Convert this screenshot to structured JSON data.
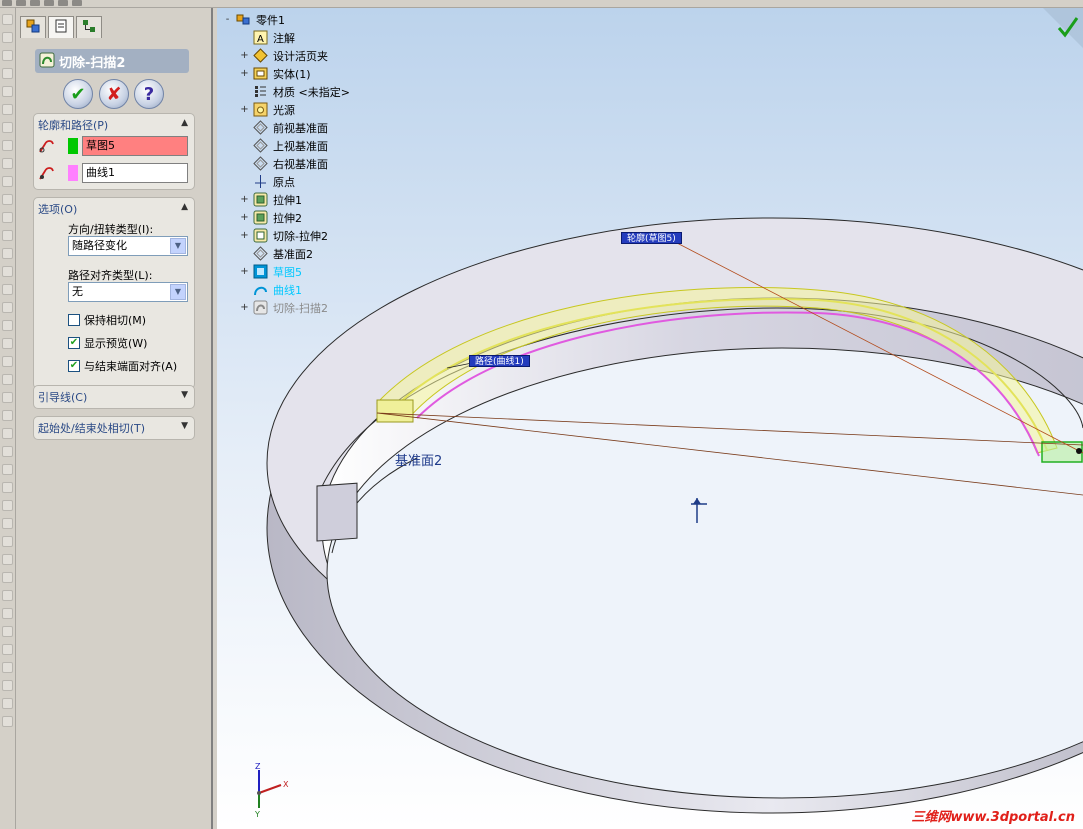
{
  "property_manager": {
    "title": "切除-扫描2",
    "buttons": {
      "ok": "✔",
      "cancel": "✘",
      "help": "?"
    },
    "profile_path": {
      "header": "轮廓和路径(P)",
      "profile_value": "草图5",
      "profile_color": "#ff8080",
      "profile_swatch": "#00c800",
      "path_value": "曲线1",
      "path_swatch": "#ff80ff"
    },
    "options": {
      "header": "选项(O)",
      "orientation_label": "方向/扭转类型(I):",
      "orientation_value": "随路径变化",
      "alignment_label": "路径对齐类型(L):",
      "alignment_value": "无",
      "keep_tangency": "保持相切(M)",
      "keep_tangency_checked": false,
      "show_preview": "显示预览(W)",
      "show_preview_checked": true,
      "align_end_faces": "与结束端面对齐(A)",
      "align_end_faces_checked": true
    },
    "guide_curves": {
      "header": "引导线(C)"
    },
    "start_end_tangency": {
      "header": "起始处/结束处相切(T)"
    }
  },
  "feature_tree": [
    {
      "label": "零件1",
      "icon": "part-icon",
      "expand": "-",
      "style": "normal"
    },
    {
      "label": "注解",
      "icon": "annotations-icon",
      "expand": "",
      "style": "normal"
    },
    {
      "label": "设计活页夹",
      "icon": "design-binder-icon",
      "expand": "+",
      "style": "normal"
    },
    {
      "label": "实体(1)",
      "icon": "solid-bodies-icon",
      "expand": "+",
      "style": "normal"
    },
    {
      "label": "材质 <未指定>",
      "icon": "material-icon",
      "expand": "",
      "style": "normal"
    },
    {
      "label": "光源",
      "icon": "lights-icon",
      "expand": "+",
      "style": "normal"
    },
    {
      "label": "前视基准面",
      "icon": "plane-icon",
      "expand": "",
      "style": "normal"
    },
    {
      "label": "上视基准面",
      "icon": "plane-icon",
      "expand": "",
      "style": "normal"
    },
    {
      "label": "右视基准面",
      "icon": "plane-icon",
      "expand": "",
      "style": "normal"
    },
    {
      "label": "原点",
      "icon": "origin-icon",
      "expand": "",
      "style": "normal"
    },
    {
      "label": "拉伸1",
      "icon": "extrude-icon",
      "expand": "+",
      "style": "normal"
    },
    {
      "label": "拉伸2",
      "icon": "extrude-icon",
      "expand": "+",
      "style": "normal"
    },
    {
      "label": "切除-拉伸2",
      "icon": "cut-extrude-icon",
      "expand": "+",
      "style": "normal"
    },
    {
      "label": "基准面2",
      "icon": "plane-icon",
      "expand": "",
      "style": "normal"
    },
    {
      "label": "草图5",
      "icon": "sketch-icon",
      "expand": "+",
      "style": "cyan"
    },
    {
      "label": "曲线1",
      "icon": "curve-icon",
      "expand": "",
      "style": "cyan"
    },
    {
      "label": "切除-扫描2",
      "icon": "cut-sweep-icon",
      "expand": "+",
      "style": "dim"
    }
  ],
  "viewport": {
    "callout_profile": "轮廓(草图5)",
    "callout_path": "路径(曲线1)",
    "plane_label": "基准面2",
    "watermark": "三维网www.3dportal.cn",
    "triad": {
      "x": "X",
      "y": "Y",
      "z": "Z"
    }
  }
}
